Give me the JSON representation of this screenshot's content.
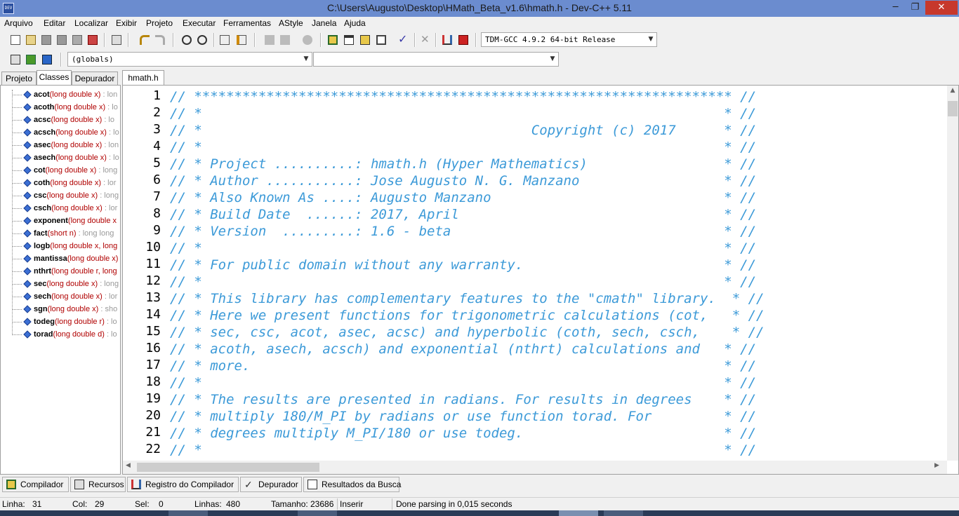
{
  "window": {
    "title": "C:\\Users\\Augusto\\Desktop\\HMath_Beta_v1.6\\hmath.h - Dev-C++ 5.11",
    "app_icon_text": "DEV",
    "minimize_glyph": "─",
    "maximize_glyph": "❐",
    "close_glyph": "✕"
  },
  "menu": [
    "Arquivo",
    "Editar",
    "Localizar",
    "Exibir",
    "Projeto",
    "Executar",
    "Ferramentas",
    "AStyle",
    "Janela",
    "Ajuda"
  ],
  "toolbar": {
    "compiler_select": "TDM-GCC 4.9.2 64-bit Release",
    "scope_select": "(globals)",
    "function_select": "",
    "dropdown_glyph": "▼"
  },
  "left_tabs": [
    "Projeto",
    "Classes",
    "Depurador"
  ],
  "left_active_tab": "Classes",
  "classes": [
    {
      "name": "acot",
      "args": "(long double x)",
      "ret": " : lon"
    },
    {
      "name": "acoth",
      "args": "(long double x)",
      "ret": " : lo"
    },
    {
      "name": "acsc",
      "args": "(long double x)",
      "ret": " : lo"
    },
    {
      "name": "acsch",
      "args": "(long double x)",
      "ret": " : lo"
    },
    {
      "name": "asec",
      "args": "(long double x)",
      "ret": " : lon"
    },
    {
      "name": "asech",
      "args": "(long double x)",
      "ret": " : lo"
    },
    {
      "name": "cot",
      "args": "(long double x)",
      "ret": " : long"
    },
    {
      "name": "coth",
      "args": "(long double x)",
      "ret": " : lor"
    },
    {
      "name": "csc",
      "args": "(long double x)",
      "ret": " : long"
    },
    {
      "name": "csch",
      "args": "(long double x)",
      "ret": " : lor"
    },
    {
      "name": "exponent",
      "args": "(long double x",
      "ret": ""
    },
    {
      "name": "fact",
      "args": "(short n)",
      "ret": " : long long"
    },
    {
      "name": "logb",
      "args": "(long double x, long",
      "ret": ""
    },
    {
      "name": "mantissa",
      "args": "(long double x)",
      "ret": ""
    },
    {
      "name": "nthrt",
      "args": "(long double r, long",
      "ret": ""
    },
    {
      "name": "sec",
      "args": "(long double x)",
      "ret": " : long"
    },
    {
      "name": "sech",
      "args": "(long double x)",
      "ret": " : lor"
    },
    {
      "name": "sgn",
      "args": "(long double x)",
      "ret": " : sho"
    },
    {
      "name": "todeg",
      "args": "(long double r)",
      "ret": " : lo"
    },
    {
      "name": "torad",
      "args": "(long double d)",
      "ret": " : lo"
    }
  ],
  "editor_tab": "hmath.h",
  "code_lines": [
    "// ******************************************************************* //",
    "// *                                                                 * //",
    "// *                                         Copyright (c) 2017      * //",
    "// *                                                                 * //",
    "// * Project ..........: hmath.h (Hyper Mathematics)                 * //",
    "// * Author ...........: Jose Augusto N. G. Manzano                  * //",
    "// * Also Known As ....: Augusto Manzano                             * //",
    "// * Build Date  ......: 2017, April                                 * //",
    "// * Version  .........: 1.6 - beta                                  * //",
    "// *                                                                 * //",
    "// * For public domain without any warranty.                         * //",
    "// *                                                                 * //",
    "// * This library has complementary features to the \"cmath\" library.  * //",
    "// * Here we present functions for trigonometric calculations (cot,   * //",
    "// * sec, csc, acot, asec, acsc) and hyperbolic (coth, sech, csch,    * //",
    "// * acoth, asech, acsch) and exponential (nthrt) calculations and   * //",
    "// * more.                                                           * //",
    "// *                                                                 * //",
    "// * The results are presented in radians. For results in degrees    * //",
    "// * multiply 180/M_PI by radians or use function torad. For         * //",
    "// * degrees multiply M_PI/180 or use todeg.                         * //",
    "// *                                                                 * //"
  ],
  "line_numbers": [
    "1",
    "2",
    "3",
    "4",
    "5",
    "6",
    "7",
    "8",
    "9",
    "10",
    "11",
    "12",
    "13",
    "14",
    "15",
    "16",
    "17",
    "18",
    "19",
    "20",
    "21",
    "22"
  ],
  "scroll_glyphs": {
    "up": "▲",
    "left": "◀",
    "right": "▶"
  },
  "bottom_tabs": [
    "Compilador",
    "Recursos",
    "Registro do Compilador",
    "Depurador",
    "Resultados da Busca"
  ],
  "status": {
    "line_label": "Linha:",
    "line_value": "31",
    "col_label": "Col:",
    "col_value": "29",
    "sel_label": "Sel:",
    "sel_value": "0",
    "lines_label": "Linhas:",
    "lines_value": "480",
    "size_label": "Tamanho:",
    "size_value": "23686",
    "mode": "Inserir",
    "message": "Done parsing in 0,015 seconds"
  },
  "colors": {
    "comment": "#3c9ad8",
    "func_name": "#000000",
    "func_args": "#b00000",
    "titlebar": "#6b8ccf"
  }
}
